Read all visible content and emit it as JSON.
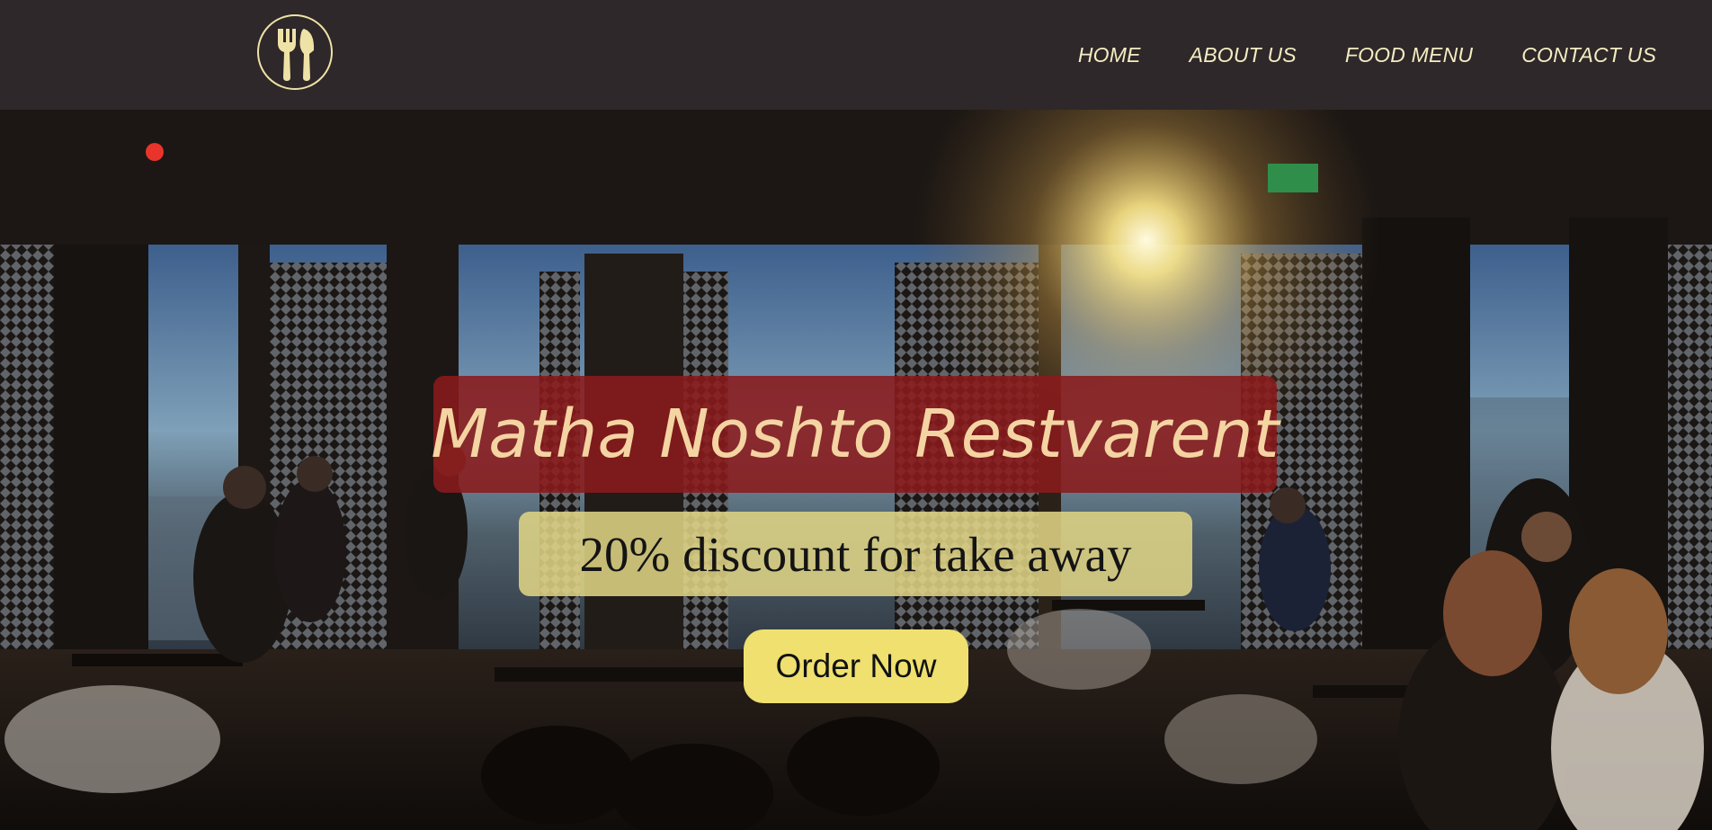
{
  "brand": {
    "logo_icon": "fork-and-knife-icon",
    "logo_color": "#efe2a6"
  },
  "nav": {
    "items": [
      {
        "label": "HOME"
      },
      {
        "label": "ABOUT US"
      },
      {
        "label": "FOOD MENU"
      },
      {
        "label": "CONTACT US"
      }
    ]
  },
  "hero": {
    "background": "restaurant-interior-photo",
    "title": "Matha Noshto Restvarent",
    "subtitle": "20% discount for take away",
    "cta_label": "Order Now"
  },
  "colors": {
    "navbar_bg": "#2e282a",
    "nav_text": "#f4ecc2",
    "title_box": "#8a1a1b",
    "title_text": "#f4d4a2",
    "discount_box": "#e2d686",
    "cta_bg": "#efe06f"
  }
}
